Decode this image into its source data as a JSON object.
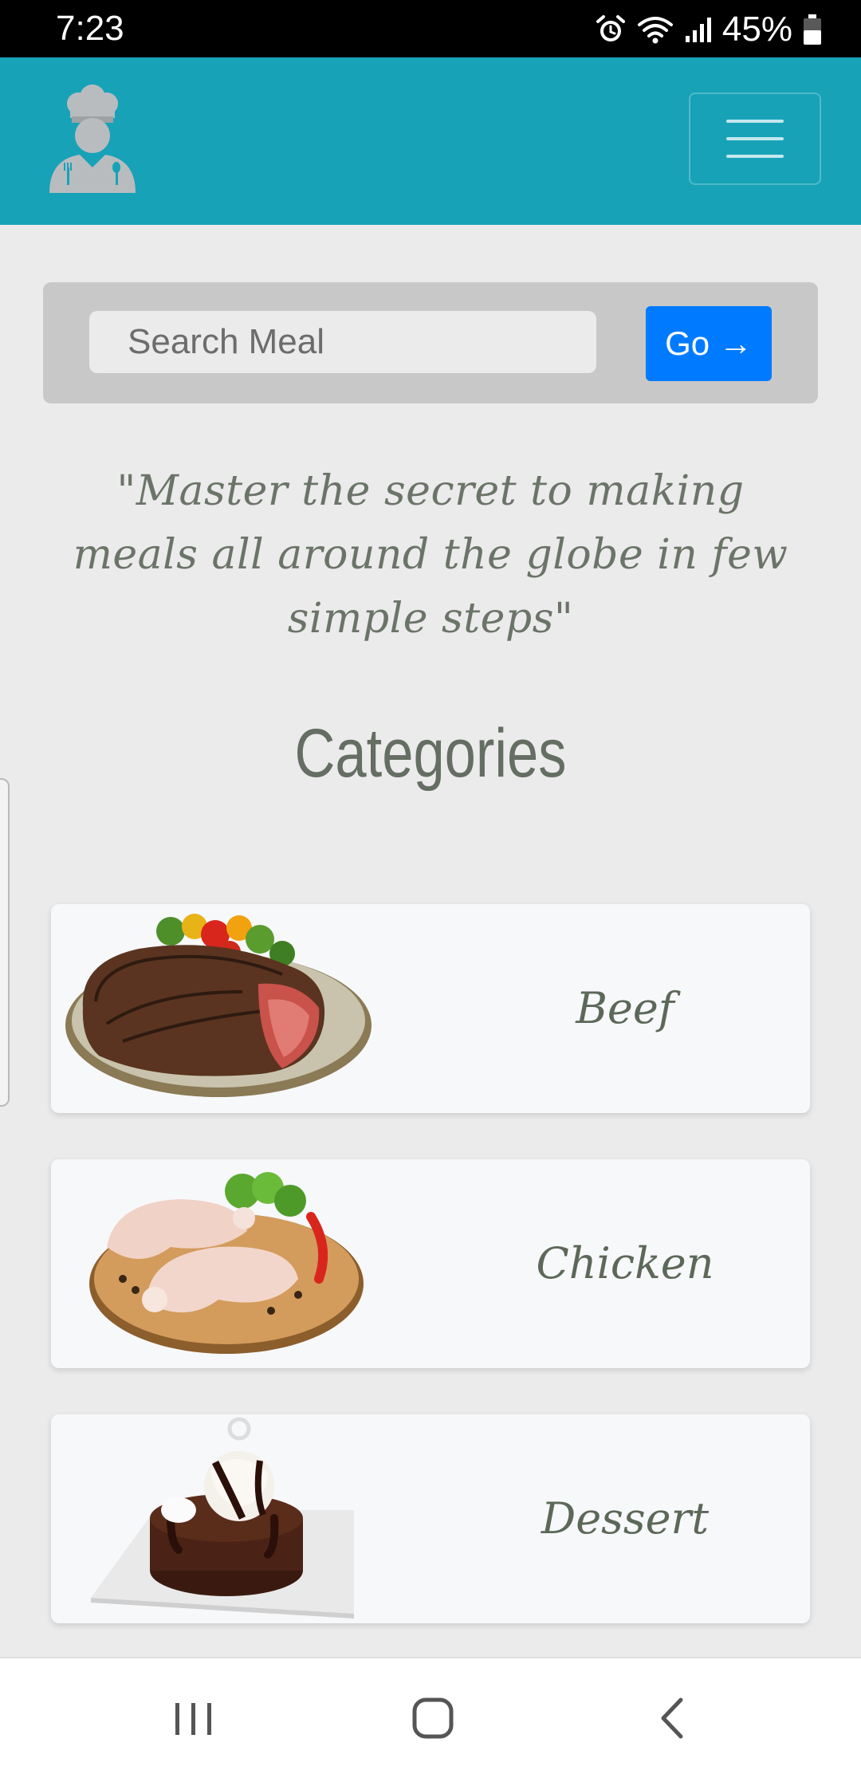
{
  "status_bar": {
    "time": "7:23",
    "battery": "45%",
    "icons": [
      "alarm-icon",
      "wifi-icon",
      "signal-icon",
      "battery-icon"
    ]
  },
  "navbar": {
    "logo_icon": "chef-logo-icon",
    "menu_icon": "hamburger-menu-icon",
    "color": "#17a2b8"
  },
  "search": {
    "placeholder": "Search Meal",
    "value": "",
    "button_label": "Go →",
    "button_color": "#007bff"
  },
  "tagline": "\"Master the secret to making meals all around the globe in few simple steps\"",
  "categories": {
    "title": "Categories",
    "items": [
      {
        "label": "Beef",
        "image_icon": "beef-steak-icon"
      },
      {
        "label": "Chicken",
        "image_icon": "chicken-legs-icon"
      },
      {
        "label": "Dessert",
        "image_icon": "chocolate-dessert-icon"
      }
    ]
  },
  "system_nav": {
    "icons": [
      "recent-apps-icon",
      "home-icon",
      "back-icon"
    ]
  }
}
